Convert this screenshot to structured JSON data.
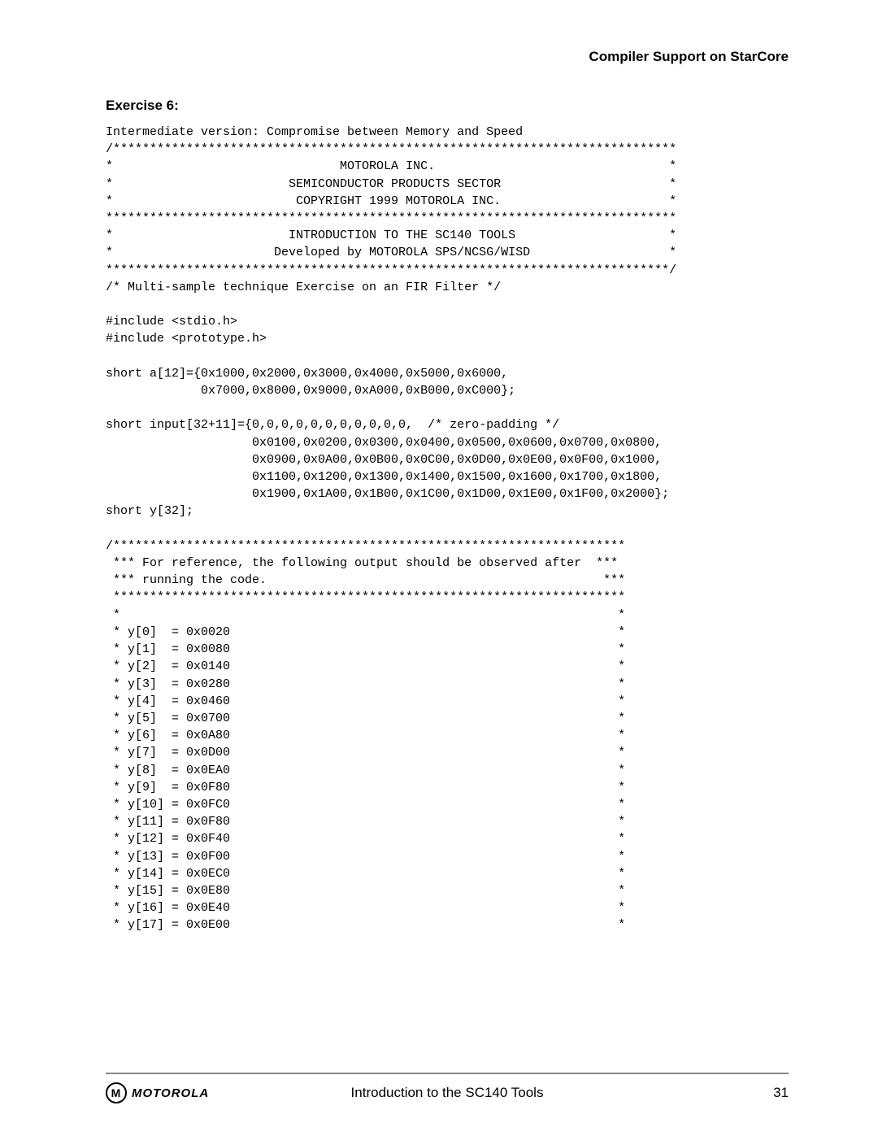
{
  "header": {
    "section_title": "Compiler Support on StarCore"
  },
  "exercise": {
    "label": "Exercise 6:"
  },
  "code": {
    "intro": "Intermediate version: Compromise between Memory and Speed",
    "banner_top": "/*****************************************************************************",
    "banner_lines": [
      "*                               MOTOROLA INC.                                *",
      "*                        SEMICONDUCTOR PRODUCTS SECTOR                       *",
      "*                         COPYRIGHT 1999 MOTOROLA INC.                       *",
      "******************************************************************************",
      "*                        INTRODUCTION TO THE SC140 TOOLS                     *",
      "*                      Developed by MOTOROLA SPS/NCSG/WISD                   *",
      "*****************************************************************************/"
    ],
    "multi_sample": "/* Multi-sample technique Exercise on an FIR Filter */",
    "includes": [
      "#include <stdio.h>",
      "#include <prototype.h>"
    ],
    "decl_a": [
      "short a[12]={0x1000,0x2000,0x3000,0x4000,0x5000,0x6000,",
      "             0x7000,0x8000,0x9000,0xA000,0xB000,0xC000};"
    ],
    "decl_input": [
      "short input[32+11]={0,0,0,0,0,0,0,0,0,0,0,  /* zero-padding */",
      "                    0x0100,0x0200,0x0300,0x0400,0x0500,0x0600,0x0700,0x0800,",
      "                    0x0900,0x0A00,0x0B00,0x0C00,0x0D00,0x0E00,0x0F00,0x1000,",
      "                    0x1100,0x1200,0x1300,0x1400,0x1500,0x1600,0x1700,0x1800,",
      "                    0x1900,0x1A00,0x1B00,0x1C00,0x1D00,0x1E00,0x1F00,0x2000};"
    ],
    "decl_y": "short y[32];",
    "ref_block_top": "/**********************************************************************",
    "ref_lines": [
      " *** For reference, the following output should be observed after  ***",
      " *** running the code.                                              ***",
      " **********************************************************************",
      " *                                                                    *"
    ],
    "y_values": [
      " * y[0]  = 0x0020                                                     *",
      " * y[1]  = 0x0080                                                     *",
      " * y[2]  = 0x0140                                                     *",
      " * y[3]  = 0x0280                                                     *",
      " * y[4]  = 0x0460                                                     *",
      " * y[5]  = 0x0700                                                     *",
      " * y[6]  = 0x0A80                                                     *",
      " * y[7]  = 0x0D00                                                     *",
      " * y[8]  = 0x0EA0                                                     *",
      " * y[9]  = 0x0F80                                                     *",
      " * y[10] = 0x0FC0                                                     *",
      " * y[11] = 0x0F80                                                     *",
      " * y[12] = 0x0F40                                                     *",
      " * y[13] = 0x0F00                                                     *",
      " * y[14] = 0x0EC0                                                     *",
      " * y[15] = 0x0E80                                                     *",
      " * y[16] = 0x0E40                                                     *",
      " * y[17] = 0x0E00                                                     *"
    ]
  },
  "footer": {
    "logo_text": "MOTOROLA",
    "logo_mark": "M",
    "center": "Introduction to the SC140 Tools",
    "page": "31"
  }
}
